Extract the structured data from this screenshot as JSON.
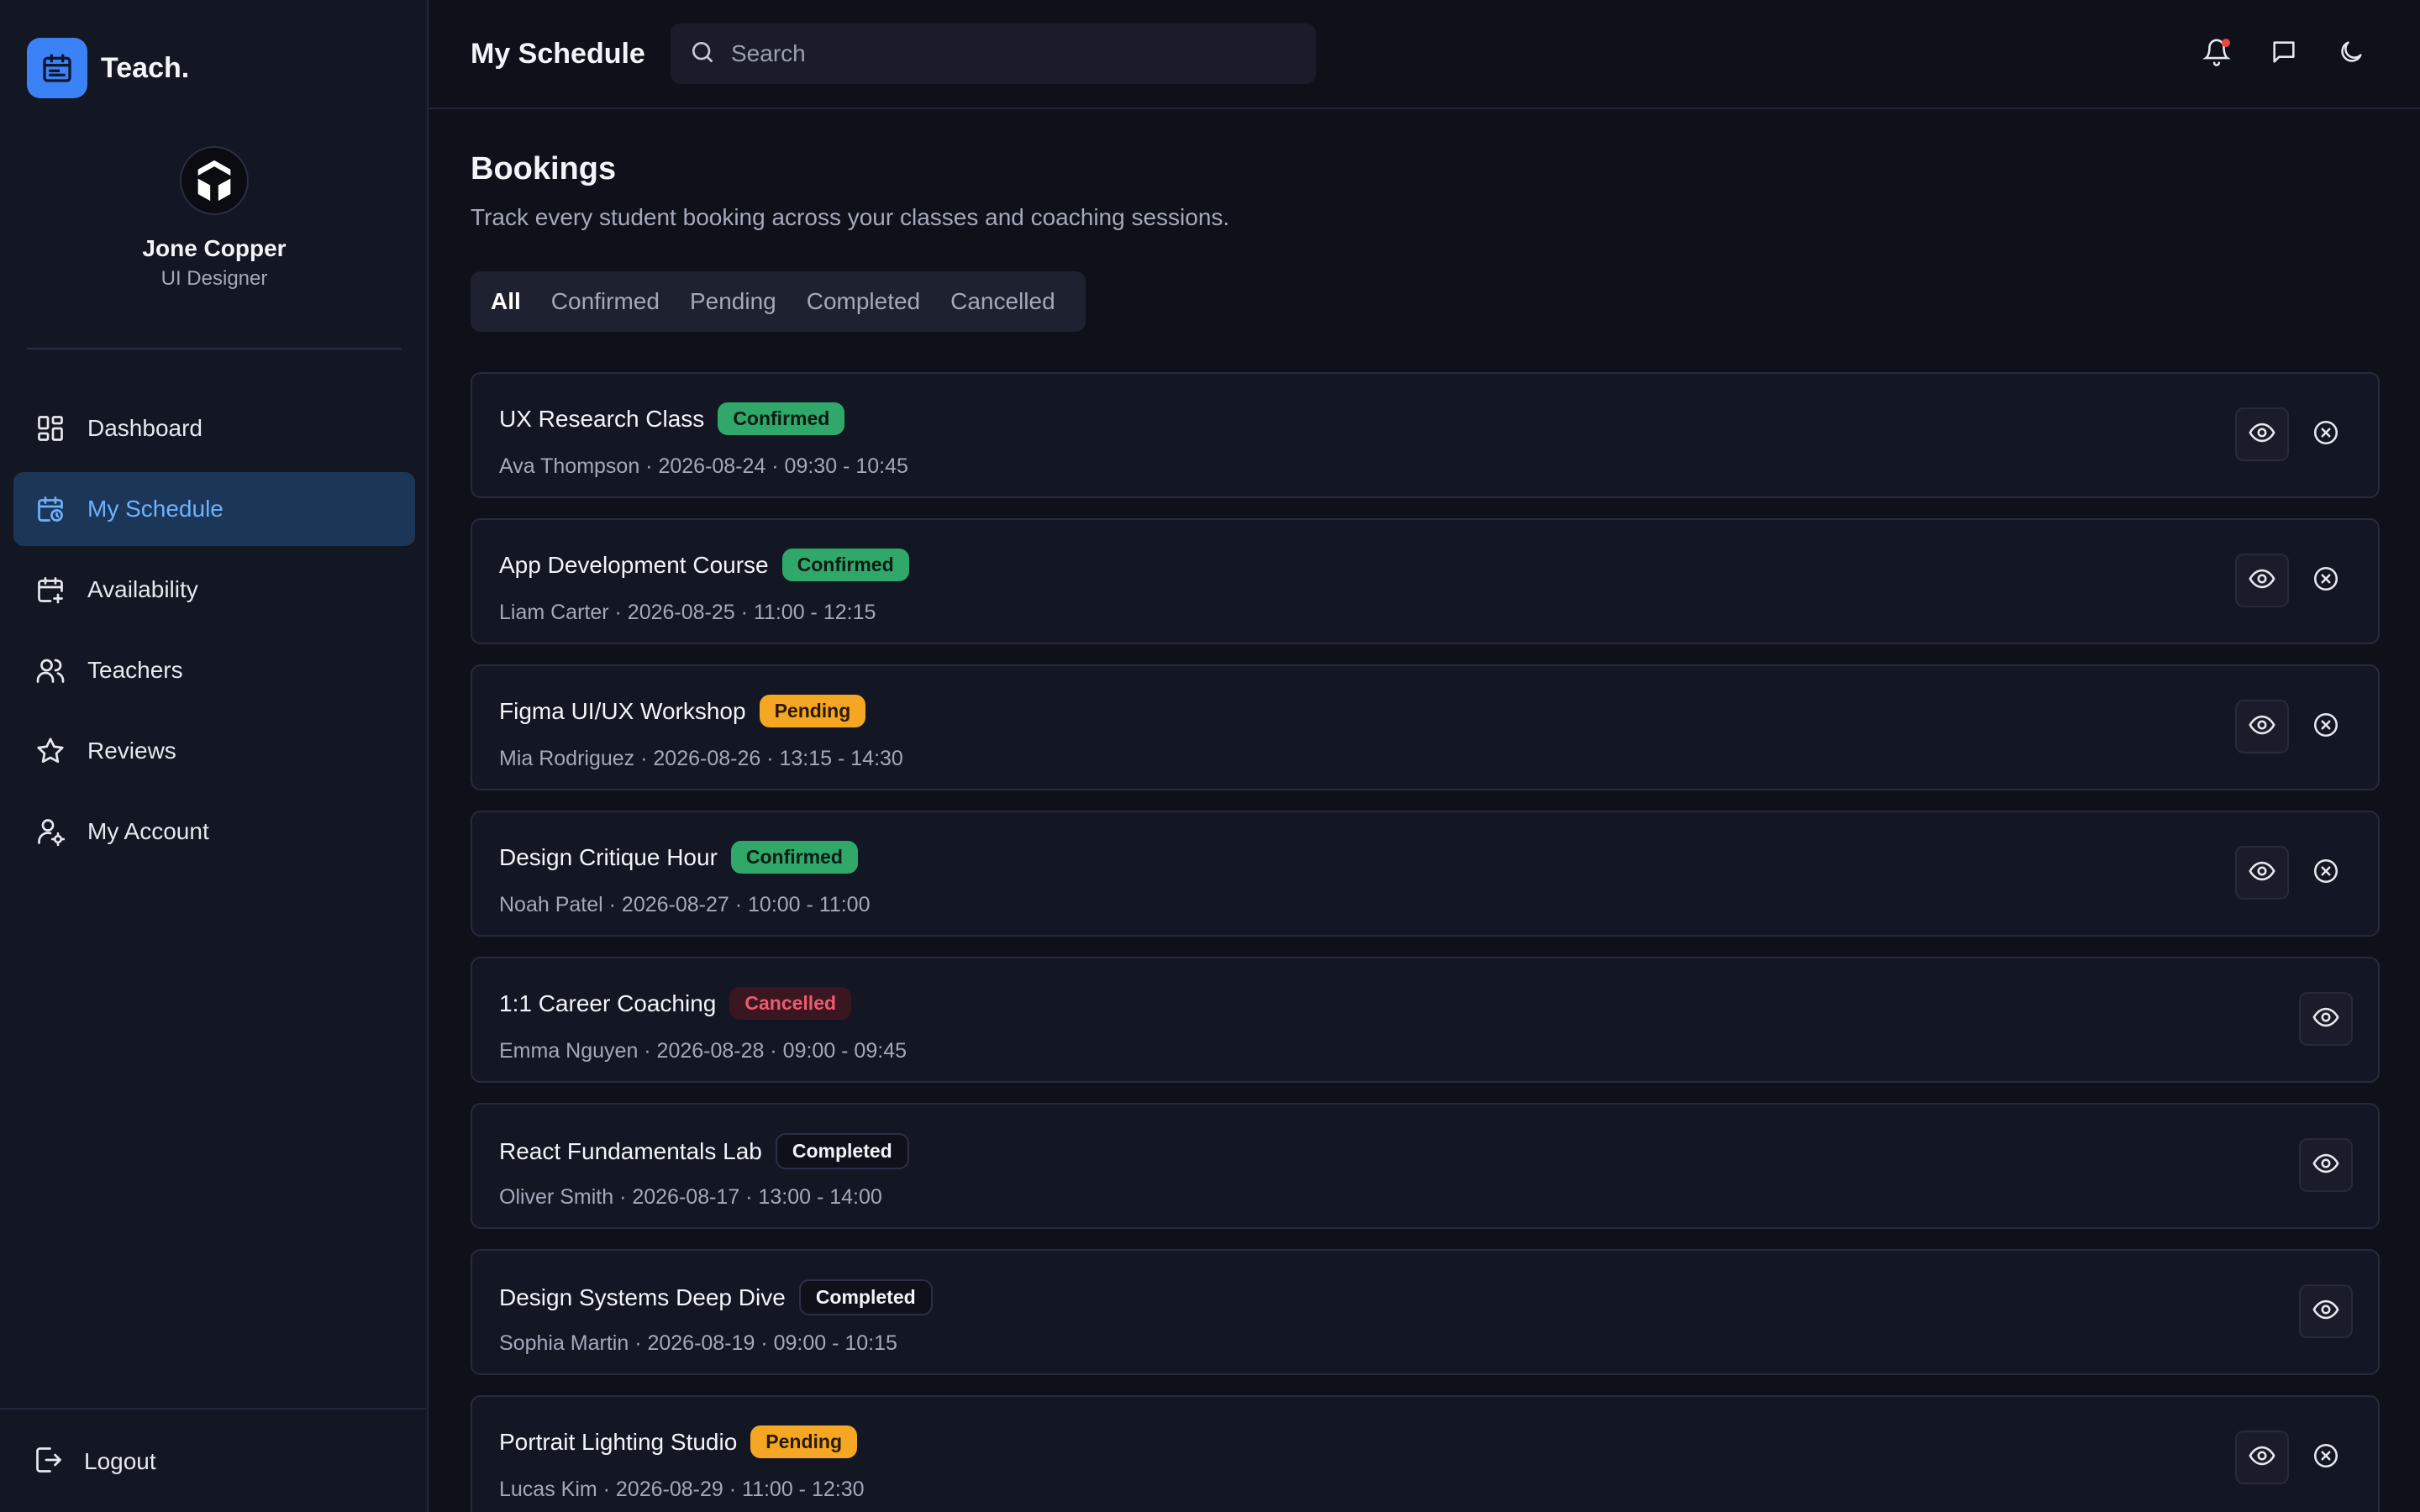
{
  "brand": {
    "name": "Teach."
  },
  "profile": {
    "name": "Jone Copper",
    "role": "UI Designer"
  },
  "nav": {
    "items": [
      {
        "label": "Dashboard",
        "icon": "dashboard-icon"
      },
      {
        "label": "My Schedule",
        "icon": "calendar-clock-icon",
        "active": true
      },
      {
        "label": "Availability",
        "icon": "calendar-plus-icon"
      },
      {
        "label": "Teachers",
        "icon": "users-icon"
      },
      {
        "label": "Reviews",
        "icon": "star-icon"
      },
      {
        "label": "My Account",
        "icon": "user-gear-icon"
      }
    ],
    "logout": "Logout"
  },
  "header": {
    "title": "My Schedule",
    "search_placeholder": "Search"
  },
  "main": {
    "title": "Bookings",
    "subtitle": "Track every student booking across your classes and coaching sessions.",
    "tabs": [
      {
        "label": "All",
        "active": true
      },
      {
        "label": "Confirmed"
      },
      {
        "label": "Pending"
      },
      {
        "label": "Completed"
      },
      {
        "label": "Cancelled"
      }
    ],
    "bookings": [
      {
        "title": "UX Research Class",
        "status": "Confirmed",
        "meta": "Ava Thompson · 2026-08-24 · 09:30 - 10:45"
      },
      {
        "title": "App Development Course",
        "status": "Confirmed",
        "meta": "Liam Carter · 2026-08-25 · 11:00 - 12:15"
      },
      {
        "title": "Figma UI/UX Workshop",
        "status": "Pending",
        "meta": "Mia Rodriguez · 2026-08-26 · 13:15 - 14:30"
      },
      {
        "title": "Design Critique Hour",
        "status": "Confirmed",
        "meta": "Noah Patel · 2026-08-27 · 10:00 - 11:00"
      },
      {
        "title": "1:1 Career Coaching",
        "status": "Cancelled",
        "meta": "Emma Nguyen · 2026-08-28 · 09:00 - 09:45"
      },
      {
        "title": "React Fundamentals Lab",
        "status": "Completed",
        "meta": "Oliver Smith · 2026-08-17 · 13:00 - 14:00"
      },
      {
        "title": "Design Systems Deep Dive",
        "status": "Completed",
        "meta": "Sophia Martin · 2026-08-19 · 09:00 - 10:15"
      },
      {
        "title": "Portrait Lighting Studio",
        "status": "Pending",
        "meta": "Lucas Kim · 2026-08-29 · 11:00 - 12:30"
      }
    ]
  },
  "colors": {
    "accent": "#3b82f6",
    "confirmed": "#2fa86a",
    "pending": "#f5a623",
    "cancelled": "#ef5a6f"
  }
}
